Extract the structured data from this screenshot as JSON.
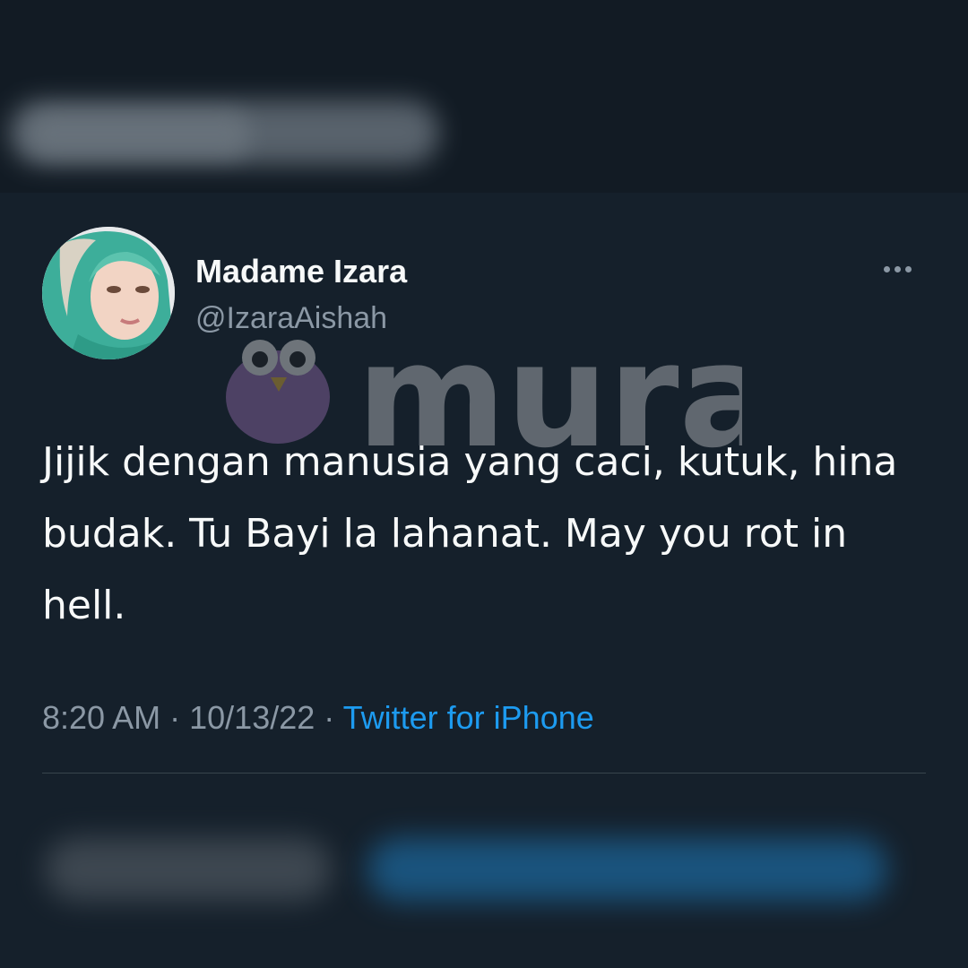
{
  "tweet": {
    "display_name": "Madame Izara",
    "handle": "@IzaraAishah",
    "text": "Jijik dengan manusia yang caci, kutuk, hina budak. Tu Bayi la lahanat. May you rot in hell.",
    "time": "8:20 AM",
    "date": "10/13/22",
    "separator": "·",
    "source": "Twitter for iPhone"
  },
  "watermark": {
    "text": "murai"
  },
  "icons": {
    "more": "more-horizontal-icon",
    "mascot": "bird-mascot-icon"
  },
  "colors": {
    "background": "#15202b",
    "text_primary": "#f7f9f9",
    "text_secondary": "#8b98a5",
    "link": "#1d9bf0",
    "divider": "#38444d"
  }
}
